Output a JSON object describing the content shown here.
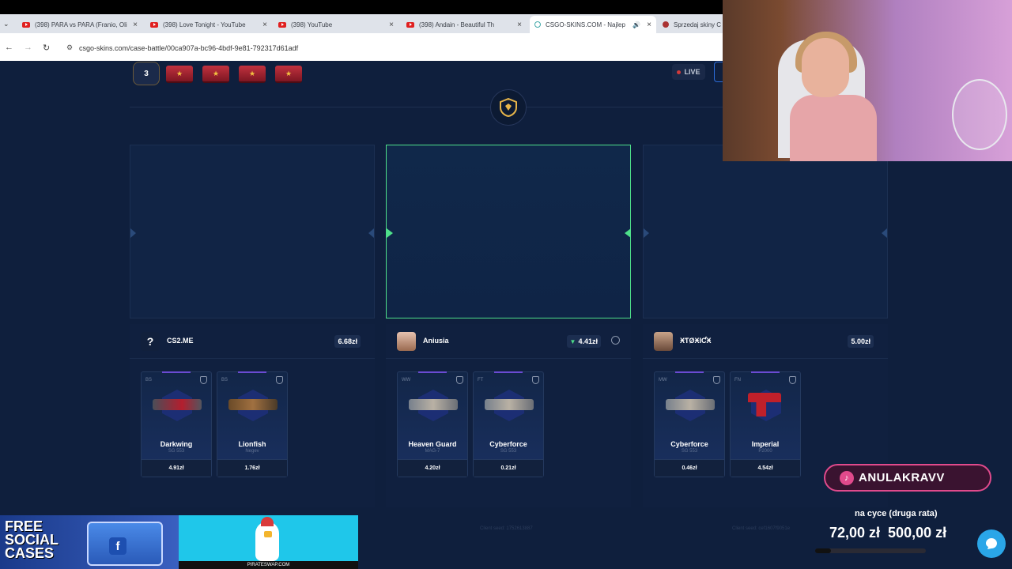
{
  "browser": {
    "tabs": [
      {
        "label": "(398) PARA vs PARA (Franio, Oli",
        "icon": "youtube-icon"
      },
      {
        "label": "(398) Love Tonight - YouTube",
        "icon": "youtube-icon"
      },
      {
        "label": "(398) YouTube",
        "icon": "youtube-icon"
      },
      {
        "label": "(398) Andain - Beautiful Th",
        "icon": "youtube-icon"
      },
      {
        "label": "CSGO-SKINS.COM - Najlep",
        "icon": "site-icon"
      },
      {
        "label": "Sprzedaj skiny C",
        "icon": "site-icon"
      }
    ],
    "url": "csgo-skins.com/case-battle/00ca907a-bc96-4bdf-9e81-792317d61adf"
  },
  "battle": {
    "round": "3",
    "live_label": "LIVE"
  },
  "players": [
    {
      "name": "CS2.ME",
      "avatar": "?",
      "value": "6.68zł",
      "items": [
        {
          "cond": "BS",
          "name": "Darkwing",
          "weapon": "SG 553",
          "price": "4.91zł",
          "style": "red"
        },
        {
          "cond": "BS",
          "name": "Lionfish",
          "weapon": "Negev",
          "price": "1.76zł",
          "style": "brown"
        }
      ]
    },
    {
      "name": "Aniusia",
      "avatar": "",
      "value": "4.41zł",
      "items": [
        {
          "cond": "WW",
          "name": "Heaven Guard",
          "weapon": "MAG-7",
          "price": "4.20zł",
          "style": "silver"
        },
        {
          "cond": "FT",
          "name": "Cyberforce",
          "weapon": "SG 553",
          "price": "0.21zł",
          "style": "silver"
        }
      ]
    },
    {
      "name": "ӾƬØӾƖƇӾ",
      "avatar": "",
      "value": "5.00zł",
      "items": [
        {
          "cond": "MW",
          "name": "Cyberforce",
          "weapon": "SG 553",
          "price": "0.46zł",
          "style": "silver"
        },
        {
          "cond": "FN",
          "name": "Imperial",
          "weapon": "P2000",
          "price": "4.54zł",
          "style": "pistol"
        }
      ]
    }
  ],
  "seeds": [
    "Client seed: 1752613887",
    "Client seed: cef1607f9051e"
  ],
  "overlay": {
    "tiktok_handle": "ANULAKRAVV",
    "goal_label": "na cyce (druga rata)",
    "goal_current": "72,00 zł",
    "goal_target": "500,00 zł",
    "goal_progress": 0.144
  },
  "ads": {
    "ad1_text": "FREE SOCIAL CASES",
    "ad2_text": "PIRATESWAP.COM"
  }
}
